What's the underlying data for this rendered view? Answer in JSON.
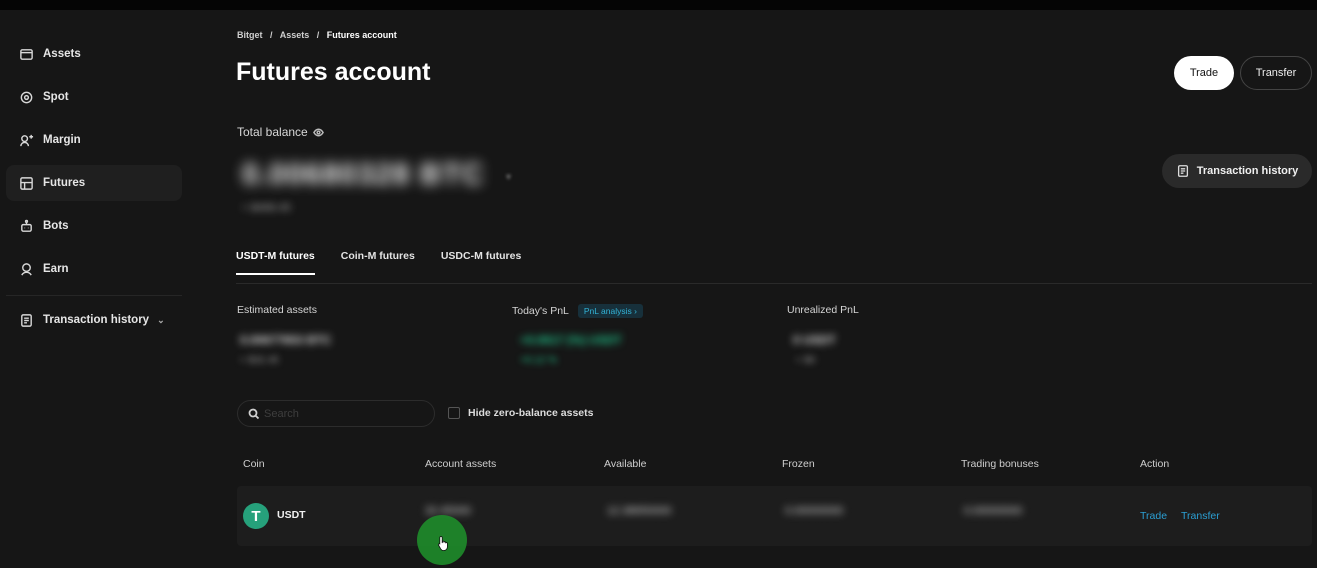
{
  "sidebar": {
    "items": [
      {
        "label": "Assets",
        "icon": "wallet-icon"
      },
      {
        "label": "Spot",
        "icon": "spot-icon"
      },
      {
        "label": "Margin",
        "icon": "margin-icon"
      },
      {
        "label": "Futures",
        "icon": "futures-icon",
        "active": true
      },
      {
        "label": "Bots",
        "icon": "bot-icon"
      },
      {
        "label": "Earn",
        "icon": "earn-icon"
      },
      {
        "label": "Transaction history",
        "icon": "receipt-icon",
        "has_chevron": true
      }
    ]
  },
  "header": {
    "breadcrumb": [
      "Bitget",
      "/",
      "Assets",
      "/",
      "Futures account"
    ],
    "title": "Futures account",
    "trade_label": "Trade",
    "transfer_label": "Transfer",
    "history_label": "Transaction history"
  },
  "balance": {
    "label": "Total balance",
    "value": "0.00680328 BTC",
    "sub": "≈ $468.45"
  },
  "tabs": [
    "USDT-M futures",
    "Coin-M futures",
    "USDC-M futures"
  ],
  "stats": {
    "estimated_label": "Estimated assets",
    "estimated_value": "0.00677653 BTC",
    "estimated_sub": "≈ $32.45",
    "pnl_label": "Today's PnL",
    "pnl_badge": "PnL analysis",
    "pnl_value": "+0.0617 (%) USDT",
    "pnl_sub": "+0.12 %",
    "unrealized_label": "Unrealized PnL",
    "unrealized_value": "0 USDT",
    "unrealized_sub": "≈ $0"
  },
  "filters": {
    "search_placeholder": "Search",
    "hide_zero_label": "Hide zero-balance assets"
  },
  "table": {
    "headers": [
      "Coin",
      "Account assets",
      "Available",
      "Frozen",
      "Trading bonuses",
      "Action"
    ],
    "rows": [
      {
        "coin": "USDT",
        "account_assets": "32.45000",
        "available": "12.38650000",
        "frozen": "0.00000000",
        "trading_bonuses": "0.00000000",
        "action_trade": "Trade",
        "action_transfer": "Transfer"
      }
    ]
  },
  "colors": {
    "accent_link": "#2b9fd3",
    "tether_green": "#26a17b",
    "positive": "#1fc98e"
  }
}
